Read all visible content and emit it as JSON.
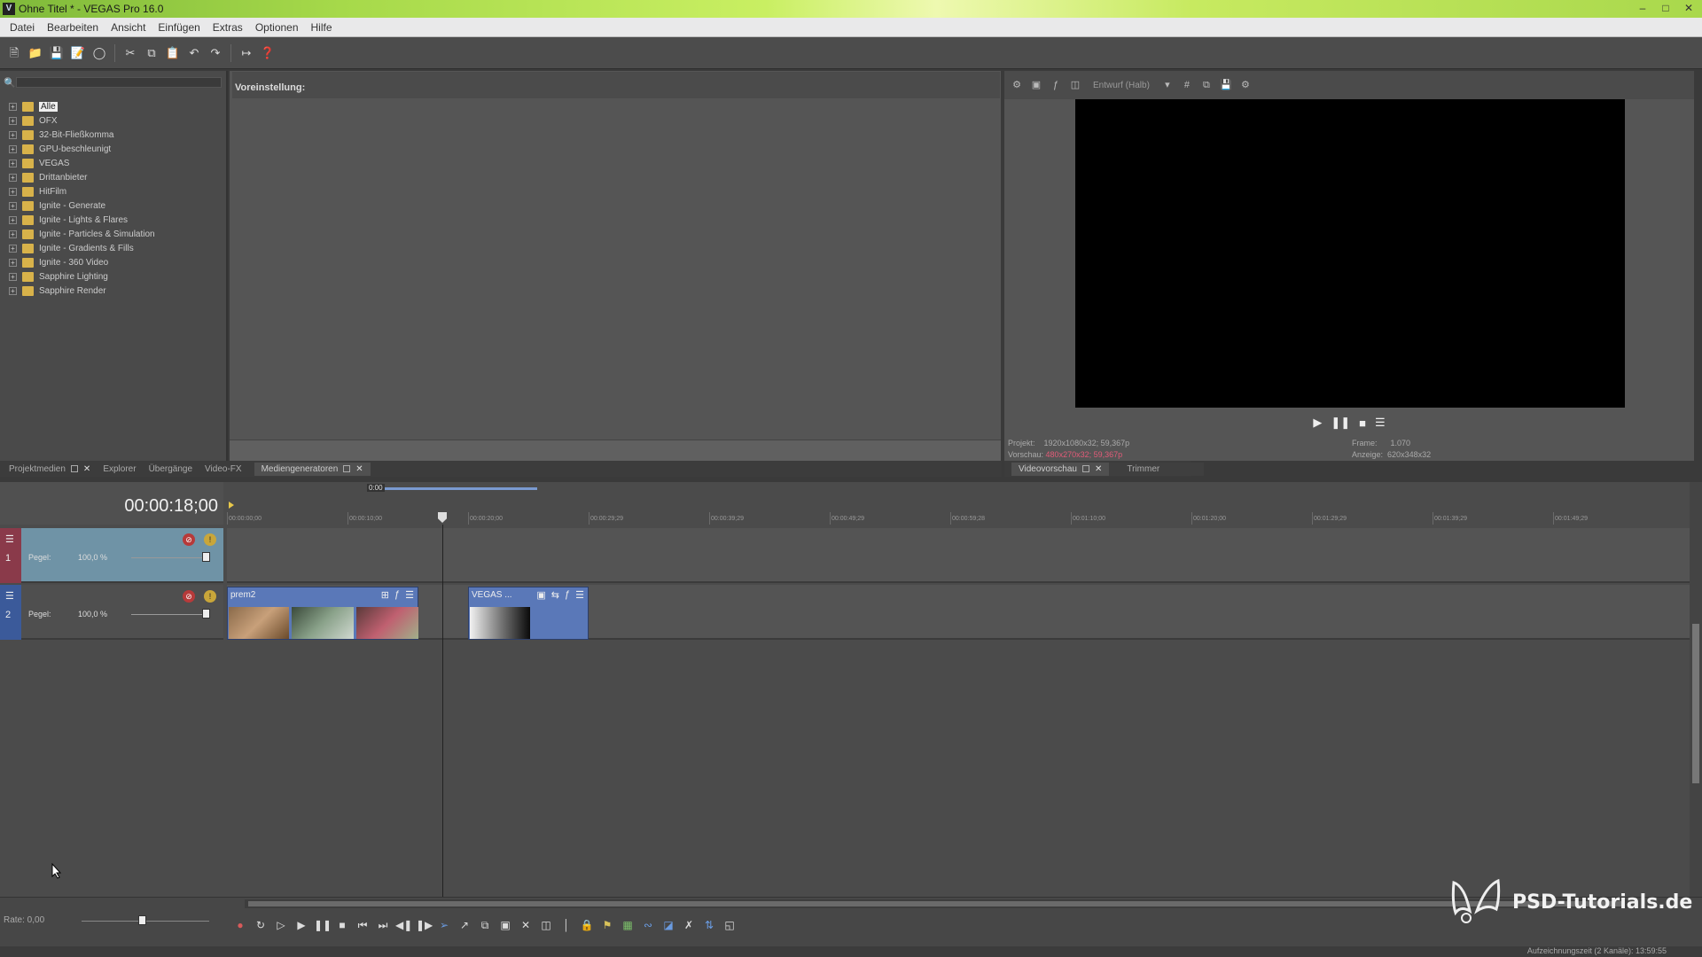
{
  "window": {
    "title": "Ohne Titel * - VEGAS Pro 16.0",
    "app_icon": "V"
  },
  "menu": [
    "Datei",
    "Bearbeiten",
    "Ansicht",
    "Einfügen",
    "Extras",
    "Optionen",
    "Hilfe"
  ],
  "toolbar_icons": [
    "new-icon",
    "open-icon",
    "save-icon",
    "save-as-icon",
    "properties-icon",
    "cut-icon",
    "copy-icon",
    "paste-icon",
    "undo-icon",
    "redo-icon",
    "snap-icon",
    "help-icon"
  ],
  "tree": {
    "items": [
      {
        "label": "Alle",
        "selected": true
      },
      {
        "label": "OFX"
      },
      {
        "label": "32-Bit-Fließkomma"
      },
      {
        "label": "GPU-beschleunigt"
      },
      {
        "label": "VEGAS"
      },
      {
        "label": "Drittanbieter"
      },
      {
        "label": "HitFilm"
      },
      {
        "label": "Ignite - Generate"
      },
      {
        "label": "Ignite - Lights & Flares"
      },
      {
        "label": "Ignite - Particles & Simulation"
      },
      {
        "label": "Ignite - Gradients & Fills"
      },
      {
        "label": "Ignite - 360 Video"
      },
      {
        "label": "Sapphire Lighting"
      },
      {
        "label": "Sapphire Render"
      }
    ]
  },
  "preset_panel": {
    "heading": "Voreinstellung:"
  },
  "dock_tabs": {
    "projektmedien": "Projektmedien",
    "explorer": "Explorer",
    "uebergaenge": "Übergänge",
    "videofx": "Video-FX",
    "mediengeneratoren": "Mediengeneratoren"
  },
  "preview": {
    "quality": "Entwurf (Halb)",
    "projekt_label": "Projekt:",
    "projekt_value": "1920x1080x32; 59,367p",
    "vorschau_label": "Vorschau:",
    "vorschau_value": "480x270x32; 59,367p",
    "frame_label": "Frame:",
    "frame_value": "1.070",
    "anzeige_label": "Anzeige:",
    "anzeige_value": "620x348x32",
    "tab_videovorschau": "Videovorschau",
    "tab_trimmer": "Trimmer"
  },
  "timeline": {
    "timecode": "00:00:18;00",
    "loop_label": "0:00",
    "ruler_ticks": [
      "00:00:00;00",
      "00:00:10;00",
      "00:00:20;00",
      "00:00:29;29",
      "00:00:39;29",
      "00:00:49;29",
      "00:00:59;28",
      "00:01:10;00",
      "00:01:20;00",
      "00:01:29;29",
      "00:01:39;29",
      "00:01:49;29"
    ],
    "tracks": [
      {
        "number": "1",
        "pegel_label": "Pegel:",
        "pegel_value": "100,0 %"
      },
      {
        "number": "2",
        "pegel_label": "Pegel:",
        "pegel_value": "100,0 %"
      }
    ],
    "clips": [
      {
        "title": "prem2"
      },
      {
        "title": "VEGAS ..."
      }
    ]
  },
  "bottom": {
    "rate": "Rate: 0,00",
    "status": "Aufzeichnungszeit (2 Kanäle): 13:59:55"
  },
  "watermark": "PSD-Tutorials.de",
  "colors": {
    "titlebar_accent": "#a6d94a",
    "track1_header": "#6f93a6",
    "clip": "#5a78b8",
    "preview_red_text": "#e25b78"
  }
}
